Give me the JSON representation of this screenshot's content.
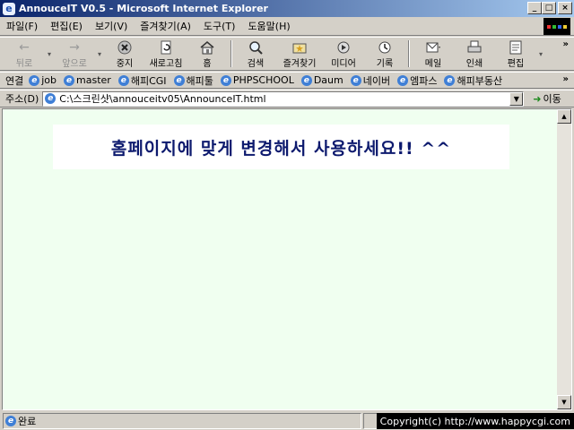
{
  "window": {
    "title": "AnnouceIT V0.5 - Microsoft Internet Explorer",
    "controls": {
      "minimize": "_",
      "maximize": "□",
      "close": "×"
    }
  },
  "menu": [
    "파일(F)",
    "편집(E)",
    "보기(V)",
    "즐겨찾기(A)",
    "도구(T)",
    "도움말(H)"
  ],
  "toolbar": {
    "back": "뒤로",
    "forward": "앞으로",
    "stop": "중지",
    "refresh": "새로고침",
    "home": "홈",
    "search": "검색",
    "favorites": "즐겨찾기",
    "media": "미디어",
    "history": "기록",
    "mail": "메일",
    "print": "인쇄",
    "edit": "편집",
    "more": "»"
  },
  "links": {
    "label": "연결",
    "items": [
      "job",
      "master",
      "해피CGI",
      "해피툴",
      "PHPSCHOOL",
      "Daum",
      "네이버",
      "엠파스",
      "해피부동산"
    ],
    "more": "»"
  },
  "address": {
    "label": "주소(D)",
    "value": "C:\\스크린샷\\annouceitv05\\AnnounceIT.html",
    "go": "이동"
  },
  "page": {
    "banner_text": "홈페이지에 맞게 변경해서 사용하세요!! ^^",
    "background": "#f0fff0"
  },
  "status": {
    "text": "완료",
    "overlay": "Copyright(c) http://www.happycgi.com"
  }
}
